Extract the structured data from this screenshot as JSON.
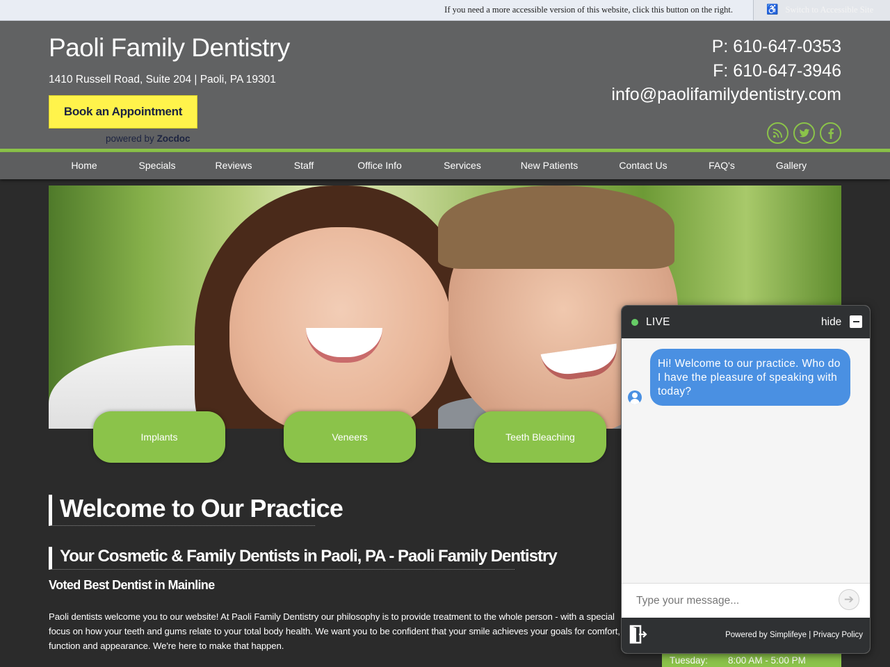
{
  "accessibility": {
    "message": "If you need a more accessible version of this website, click this button on the right.",
    "button_label": "Switch to Accessible Site",
    "icon": "wheelchair-icon"
  },
  "header": {
    "title": "Paoli Family Dentistry",
    "address": "1410 Russell Road, Suite 204 | Paoli, PA 19301",
    "book_button": "Book an Appointment",
    "powered_prefix": "powered by",
    "powered_brand": "Zocdoc",
    "phone": "P: 610-647-0353",
    "fax": "F: 610-647-3946",
    "email": "info@paolifamilydentistry.com",
    "social_icons": [
      "rss-icon",
      "twitter-icon",
      "facebook-icon"
    ]
  },
  "nav": {
    "items": [
      "Home",
      "Specials",
      "Reviews",
      "Staff",
      "Office Info",
      "Services",
      "New Patients",
      "Contact Us",
      "FAQ's",
      "Gallery"
    ]
  },
  "features": {
    "items": [
      "Implants",
      "Veneers",
      "Teeth Bleaching"
    ]
  },
  "content": {
    "welcome_heading": "Welcome to Our Practice",
    "subheading": "Your Cosmetic & Family Dentists in Paoli, PA - Paoli Family Dentistry",
    "voted": "Voted Best Dentist in Mainline",
    "intro": "Paoli dentists welcome you to our website! At Paoli Family Dentistry our philosophy is to provide treatment to the whole person - with a special focus on how your teeth and gums relate to your total body health. We want you to be confident that your smile achieves your goals for comfort, function and appearance. We're here to make that happen."
  },
  "hours": {
    "day": "Tuesday:",
    "time": "8:00 AM - 5:00 PM"
  },
  "chat": {
    "status": "LIVE",
    "hide_label": "hide",
    "message": "Hi! Welcome to our practice.  Who do I have the pleasure of speaking with today?",
    "input_placeholder": "Type your message...",
    "powered_by": "Powered by Simplifeye | Privacy Policy"
  },
  "colors": {
    "accent_green": "#8bc34a",
    "header_gray": "#616263",
    "page_bg": "#2b2b2b",
    "book_yellow": "#fff34b",
    "chat_blue": "#4a90e2"
  }
}
